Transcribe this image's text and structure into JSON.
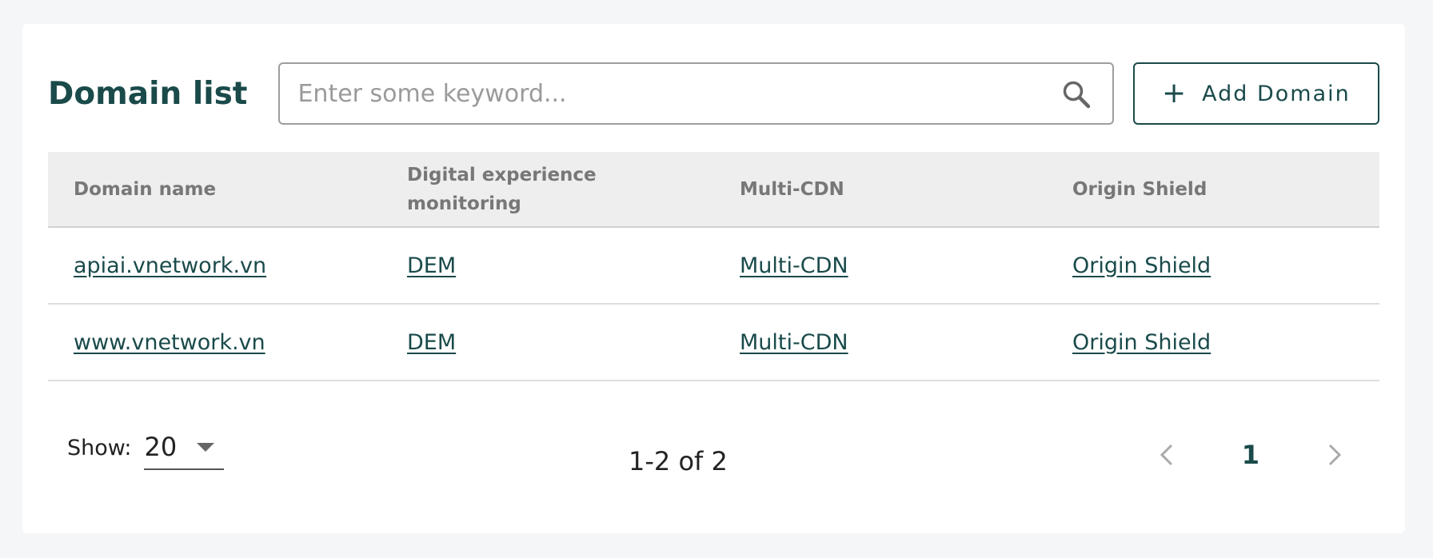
{
  "header": {
    "title": "Domain list",
    "search_placeholder": "Enter some keyword...",
    "add_button_label": "Add Domain"
  },
  "table": {
    "columns": [
      "Domain name",
      "Digital experience monitoring",
      "Multi-CDN",
      "Origin Shield"
    ],
    "rows": [
      {
        "domain": "apiai.vnetwork.vn",
        "dem": "DEM",
        "multicdn": "Multi-CDN",
        "origin": "Origin Shield"
      },
      {
        "domain": "www.vnetwork.vn",
        "dem": "DEM",
        "multicdn": "Multi-CDN",
        "origin": "Origin Shield"
      }
    ]
  },
  "footer": {
    "show_label": "Show:",
    "page_size": "20",
    "range_text": "1-2 of 2",
    "current_page": "1"
  },
  "icons": {
    "search": "search-icon",
    "plus": "plus-icon",
    "prev": "chevron-left-icon",
    "next": "chevron-right-icon",
    "dropdown": "caret-down-icon"
  },
  "colors": {
    "accent": "#1a4a4a",
    "header_bg": "#eeeeee",
    "page_bg": "#f5f6f8"
  }
}
